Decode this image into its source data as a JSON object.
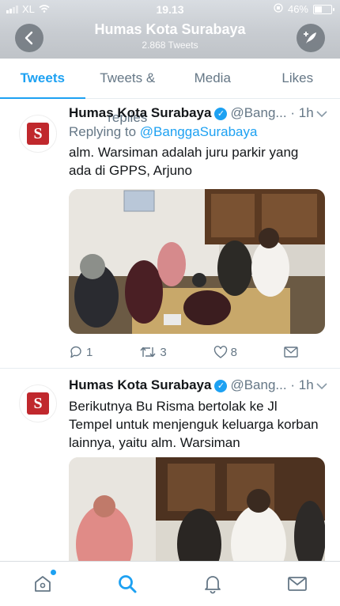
{
  "status": {
    "carrier": "XL",
    "time": "19.13",
    "battery": "46%",
    "battery_level": 0.46
  },
  "header": {
    "title": "Humas Kota Surabaya",
    "subtitle": "2.868 Tweets"
  },
  "tabs": [
    {
      "label": "Tweets",
      "active": true
    },
    {
      "label": "Tweets & replies",
      "active": false
    },
    {
      "label": "Media",
      "active": false
    },
    {
      "label": "Likes",
      "active": false
    }
  ],
  "tweets": [
    {
      "name": "Humas Kota Surabaya",
      "handle": "@Bang...",
      "time": "1h",
      "reply_prefix": "Replying to",
      "reply_to": "@BanggaSurabaya",
      "text": "alm. Warsiman adalah juru parkir yang ada di GPPS, Arjuno",
      "replies": "1",
      "retweets": "3",
      "likes": "8"
    },
    {
      "name": "Humas Kota Surabaya",
      "handle": "@Bang...",
      "time": "1h",
      "text": "Berikutnya Bu Risma bertolak ke Jl Tempel untuk menjenguk keluarga korban lainnya, yaitu alm. Warsiman"
    }
  ],
  "avatar_letter": "S",
  "separator": "·",
  "colors": {
    "accent": "#1da1f2",
    "brand": "#c0282d",
    "muted": "#657786"
  },
  "bottom_nav": [
    "home-icon",
    "search-icon",
    "notifications-icon",
    "messages-icon"
  ]
}
